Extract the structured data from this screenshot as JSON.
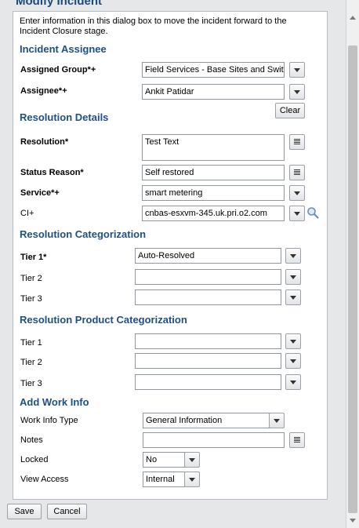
{
  "dialog": {
    "title": "Modify Incident",
    "intro": "Enter information in this dialog box to move the incident forward to the Incident Closure stage."
  },
  "sections": {
    "assignee": "Incident Assignee",
    "resolution": "Resolution Details",
    "res_cat": "Resolution Categorization",
    "res_prod_cat": "Resolution Product Categorization",
    "work_info": "Add Work Info"
  },
  "labels": {
    "assigned_group": "Assigned Group*+",
    "assignee": "Assignee*+",
    "resolution": "Resolution*",
    "status_reason": "Status Reason*",
    "service": "Service*+",
    "ci": "CI+",
    "tier1_req": "Tier 1*",
    "tier2": "Tier 2",
    "tier3": "Tier 3",
    "ptier1": "Tier 1",
    "ptier2": "Tier 2",
    "ptier3": "Tier 3",
    "work_info_type": "Work Info Type",
    "notes": "Notes",
    "locked": "Locked",
    "view_access": "View Access"
  },
  "values": {
    "assigned_group": "Field Services - Base Sites and Switch",
    "assignee": "Ankit Patidar",
    "resolution": "Test Text",
    "status_reason": "Self restored",
    "service": "smart metering",
    "ci": "cnbas-esxvm-345.uk.pri.o2.com",
    "tier1": "Auto-Resolved",
    "tier2": "",
    "tier3": "",
    "ptier1": "",
    "ptier2": "",
    "ptier3": "",
    "work_info_type": "General Information",
    "notes": "",
    "locked": "No",
    "view_access": "Internal"
  },
  "buttons": {
    "clear": "Clear",
    "save": "Save",
    "cancel": "Cancel"
  }
}
